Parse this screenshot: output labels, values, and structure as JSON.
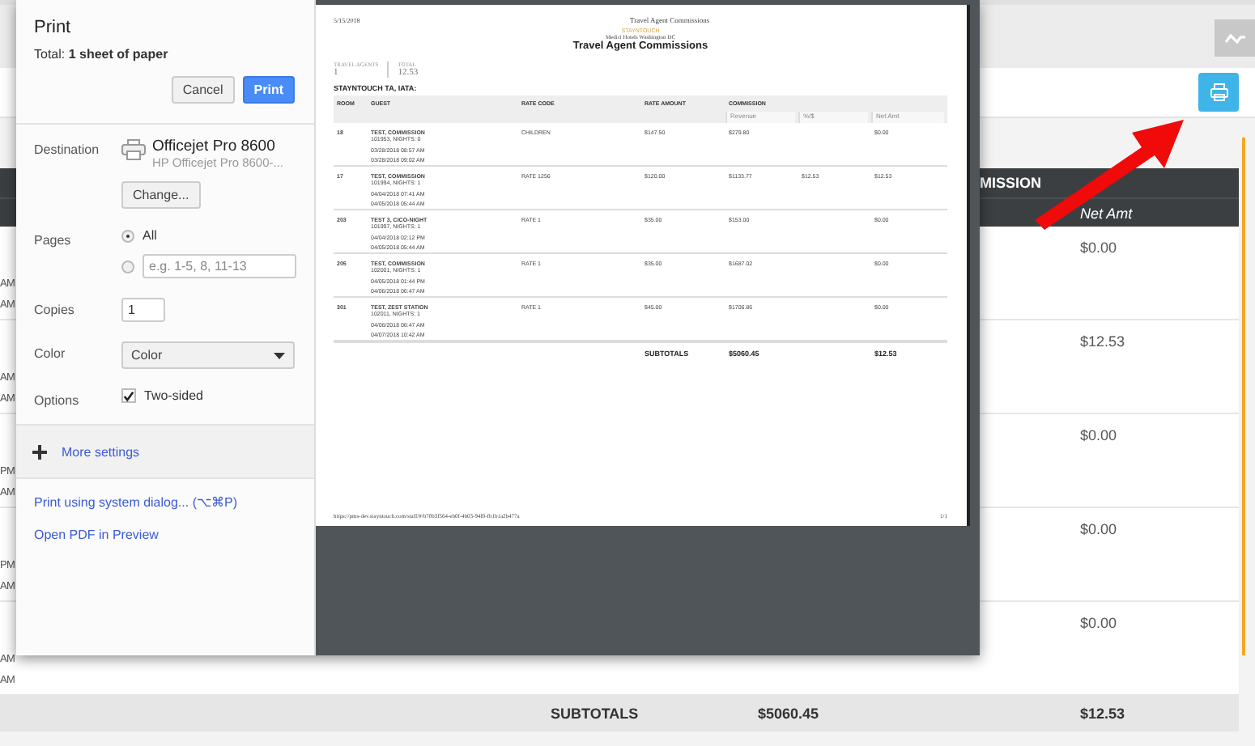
{
  "app": {
    "header": {
      "group": "MISSION",
      "column": "Net Amt"
    },
    "rows": [
      {
        "times": [
          "AM",
          "AM"
        ],
        "net_amt": "$0.00"
      },
      {
        "times": [
          "AM",
          "AM"
        ],
        "net_amt": "$12.53"
      },
      {
        "times": [
          "PM",
          "AM"
        ],
        "net_amt": "$0.00"
      },
      {
        "times": [
          "PM",
          "AM"
        ],
        "net_amt": "$0.00"
      },
      {
        "times": [
          "AM",
          "AM"
        ],
        "net_amt": "$0.00"
      }
    ],
    "subtotals": {
      "label": "SUBTOTALS",
      "revenue": "$5060.45",
      "net_amt": "$12.53"
    }
  },
  "print_dialog": {
    "title": "Print",
    "total": "Total: **1 sheet of paper**",
    "buttons": [
      {
        "label": "Cancel",
        "kind": "secondary"
      },
      {
        "label": "Print",
        "kind": "primary"
      }
    ],
    "destination": {
      "label": "Destination",
      "printer": "Officejet Pro 8600",
      "printer_detail": "HP Officejet Pro 8600-...",
      "change": "Change..."
    },
    "pages": {
      "label": "Pages",
      "options": [
        {
          "kind": "label",
          "label": "All",
          "selected": true
        },
        {
          "kind": "field",
          "placeholder": "e.g. 1-5, 8, 11-13",
          "selected": false
        }
      ]
    },
    "copies": {
      "label": "Copies",
      "value": "1"
    },
    "color": {
      "label": "Color",
      "value": "Color"
    },
    "options": {
      "label": "Options",
      "items": [
        {
          "label": "Two-sided",
          "checked": true
        }
      ]
    },
    "more_settings": {
      "label": "More settings",
      "expanded": false
    },
    "links": [
      "Print using system dialog... (⌥⌘P)",
      "Open PDF in Preview"
    ],
    "preview": {
      "date": "5/15/2018",
      "header_title": "Travel Agent Commissions",
      "logo": "STAYNTOUCH",
      "hotel": "Medici Hotels Washington DC",
      "title": "Travel Agent Commissions",
      "stats": [
        {
          "label": "TRAVEL AGENTS",
          "value": "1"
        },
        {
          "label": "TOTAL",
          "value": "12.53"
        }
      ],
      "group": "STAYNTOUCH TA, IATA:",
      "columns": [
        "ROOM",
        "GUEST",
        "RATE CODE",
        "RATE AMOUNT",
        "COMMISSION"
      ],
      "subcolumns": [
        "Revenue",
        "%/$",
        "Net Amt"
      ],
      "rows": [
        {
          "room": "18",
          "guest": "TEST, COMMISSION",
          "detail": "101953, NIGHTS: 0",
          "dates": [
            "03/28/2018  08:57 AM",
            "03/28/2018  09:02 AM"
          ],
          "rate_code": "CHILDREN",
          "rate_amount": "$147.50",
          "revenue": "$279.80",
          "net_amt": "$0.00"
        },
        {
          "room": "17",
          "guest": "TEST, COMMISSION",
          "detail": "101994, NIGHTS: 1",
          "dates": [
            "04/04/2018  07:41 AM",
            "04/05/2018  05:44 AM"
          ],
          "rate_code": "RATE 1256",
          "rate_amount": "$120.00",
          "revenue": "$1133.77",
          "percent": "$12.53",
          "net_amt": "$12.53"
        },
        {
          "room": "203",
          "guest": "TEST 3, CICO-NIGHT",
          "detail": "101997, NIGHTS: 1",
          "dates": [
            "04/04/2018  02:12 PM",
            "04/05/2018  05:44 AM"
          ],
          "rate_code": "RATE 1",
          "rate_amount": "$35.00",
          "revenue": "$153.00",
          "net_amt": "$0.00"
        },
        {
          "room": "205",
          "guest": "TEST, COMMISSION",
          "detail": "102001, NIGHTS: 1",
          "dates": [
            "04/05/2018  01:44 PM",
            "04/06/2018  06:47 AM"
          ],
          "rate_code": "RATE 1",
          "rate_amount": "$35.00",
          "revenue": "$1687.02",
          "net_amt": "$0.00"
        },
        {
          "room": "301",
          "guest": "TEST, ZEST STATION",
          "detail": "102011, NIGHTS: 1",
          "dates": [
            "04/06/2018  06:47 AM",
            "04/07/2018  10:42 AM"
          ],
          "rate_code": "RATE 1",
          "rate_amount": "$45.00",
          "revenue": "$1706.86",
          "net_amt": "$0.00"
        }
      ],
      "subtotals": {
        "label": "SUBTOTALS",
        "revenue": "$5060.45",
        "net_amt": "$12.53"
      },
      "footer_url": "https://pms-dev.stayntouch.com/staff/#/b70b3f564-eb0f-4b03-94f0-fb1b1a2b477a",
      "page_number": "1/1"
    }
  }
}
